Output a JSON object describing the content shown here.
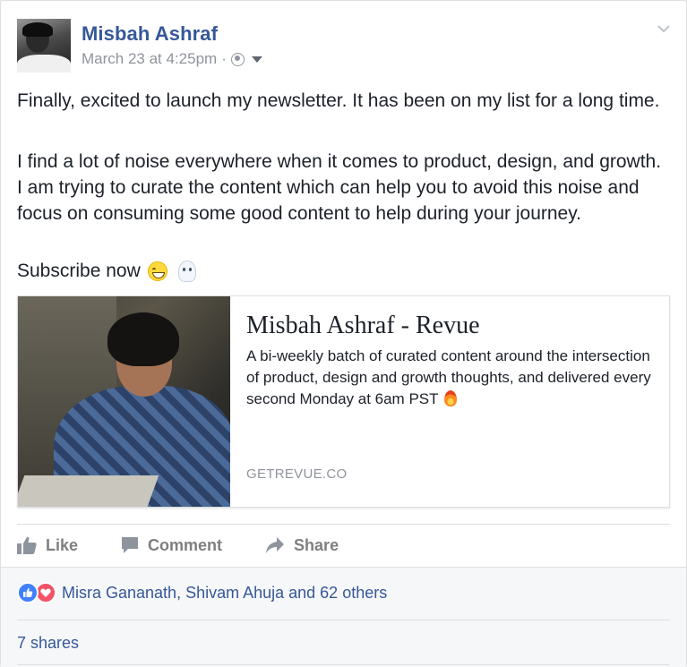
{
  "post": {
    "author": "Misbah Ashraf",
    "timestamp": "March 23 at 4:25pm",
    "separator": "·",
    "audience_icon": "globe-icon",
    "menu_icon": "chevron-down-icon",
    "paragraphs": [
      "Finally, excited to launch my newsletter. It has been on my list for a long time.",
      "I find a lot of noise everywhere when it comes to product, design, and growth. I am trying to curate the content which can help you to avoid this noise and focus on consuming some good content to help during your journey.",
      "Subscribe now"
    ],
    "emojis": [
      "grinning-face-icon",
      "ghost-icon"
    ]
  },
  "link_card": {
    "title": "Misbah Ashraf - Revue",
    "description": "A bi-weekly batch of curated content around the intersection of product, design and growth thoughts, and delivered every second Monday at 6am PST",
    "description_emoji": "fire-icon",
    "domain": "GETREVUE.CO"
  },
  "actions": [
    {
      "label": "Like",
      "icon": "thumbs-up-icon"
    },
    {
      "label": "Comment",
      "icon": "comment-icon"
    },
    {
      "label": "Share",
      "icon": "share-arrow-icon"
    }
  ],
  "footer": {
    "reactors": "Misra Gananath, Shivam Ahuja and 62 others",
    "reaction_icons": [
      "like-reaction-icon",
      "love-reaction-icon"
    ],
    "shares": "7 shares"
  },
  "colors": {
    "link_blue": "#365899",
    "muted_gray": "#90949c",
    "text": "#1d2129",
    "like_blue": "#4080ff",
    "love_red": "#f25268"
  }
}
